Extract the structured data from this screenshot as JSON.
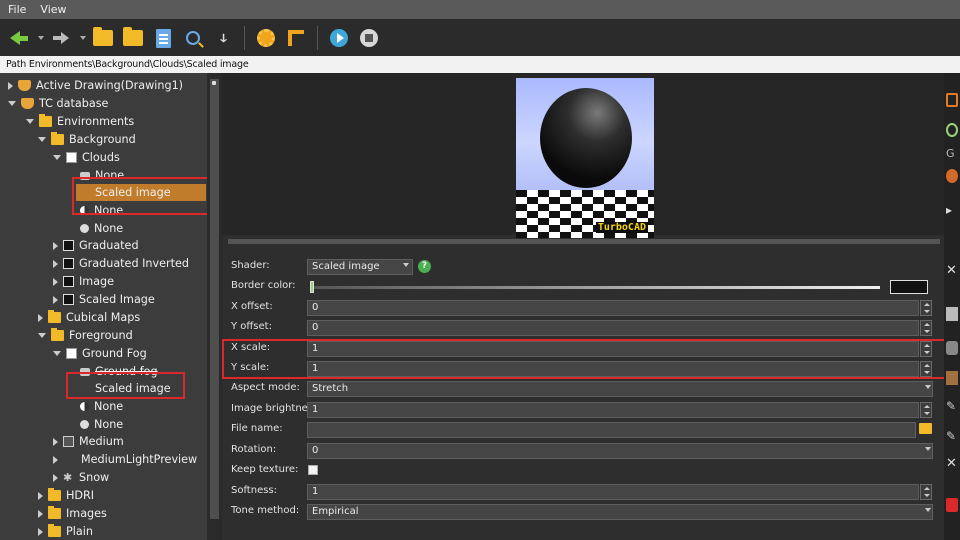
{
  "menu": {
    "file": "File",
    "view": "View"
  },
  "path": "Path Environments\\Background\\Clouds\\Scaled image",
  "tree": {
    "items": [
      {
        "label": "Active Drawing(Drawing1)"
      },
      {
        "label": "TC database"
      },
      {
        "label": "Environments"
      },
      {
        "label": "Background"
      },
      {
        "label": "Clouds"
      },
      {
        "label": "None"
      },
      {
        "label": "Scaled image"
      },
      {
        "label": "None"
      },
      {
        "label": "None"
      },
      {
        "label": "Graduated"
      },
      {
        "label": "Graduated Inverted"
      },
      {
        "label": "Image"
      },
      {
        "label": "Scaled Image"
      },
      {
        "label": "Cubical Maps"
      },
      {
        "label": "Foreground"
      },
      {
        "label": "Ground Fog"
      },
      {
        "label": "Ground fog"
      },
      {
        "label": "Scaled image"
      },
      {
        "label": "None"
      },
      {
        "label": "None"
      },
      {
        "label": "Medium"
      },
      {
        "label": "MediumLightPreview"
      },
      {
        "label": "Snow"
      },
      {
        "label": "HDRI"
      },
      {
        "label": "Images"
      },
      {
        "label": "Plain"
      }
    ]
  },
  "preview": {
    "brand": "TurboCAD"
  },
  "props": {
    "shader_label": "Shader:",
    "shader_value": "Scaled image",
    "border_color_label": "Border color:",
    "x_offset_label": "X offset:",
    "x_offset_value": "0",
    "y_offset_label": "Y offset:",
    "y_offset_value": "0",
    "x_scale_label": "X scale:",
    "x_scale_value": "1",
    "y_scale_label": "Y scale:",
    "y_scale_value": "1",
    "aspect_label": "Aspect mode:",
    "aspect_value": "Stretch",
    "brightness_label": "Image brightness:",
    "brightness_value": "1",
    "file_label": "File name:",
    "file_value": "",
    "rotation_label": "Rotation:",
    "rotation_value": "0",
    "keep_label": "Keep texture:",
    "keep_checked": true,
    "softness_label": "Softness:",
    "softness_value": "1",
    "tone_label": "Tone method:",
    "tone_value": "Empirical"
  },
  "colors": {
    "selection": "#c07c2a",
    "highlight": "#d9292a",
    "folder": "#f2b928"
  }
}
